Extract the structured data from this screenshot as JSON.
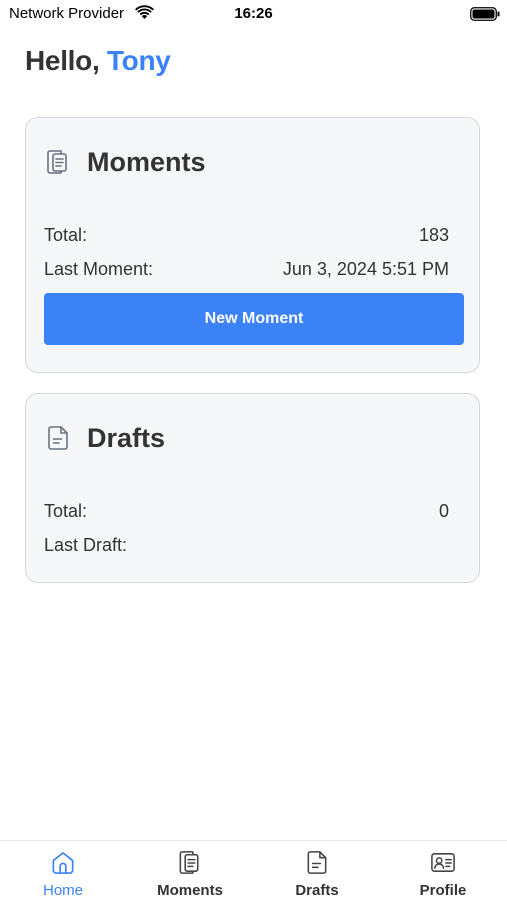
{
  "status_bar": {
    "carrier": "Network Provider",
    "time": "16:26"
  },
  "greeting": {
    "prefix": "Hello,",
    "name": "Tony"
  },
  "moments_card": {
    "icon": "moments-icon",
    "title": "Moments",
    "total_label": "Total:",
    "total_value": "183",
    "last_label": "Last Moment:",
    "last_value": "Jun 3, 2024 5:51 PM",
    "button_label": "New Moment"
  },
  "drafts_card": {
    "icon": "document-icon",
    "title": "Drafts",
    "total_label": "Total:",
    "total_value": "0",
    "last_label": "Last Draft:",
    "last_value": ""
  },
  "tab_bar": {
    "active": "Home",
    "tabs": [
      {
        "label": "Home",
        "icon": "home-icon"
      },
      {
        "label": "Moments",
        "icon": "moments-icon"
      },
      {
        "label": "Drafts",
        "icon": "document-icon"
      },
      {
        "label": "Profile",
        "icon": "profile-card-icon"
      }
    ]
  },
  "colors": {
    "accent": "#3b82f6",
    "text": "#333333",
    "card_bg": "#f6f7f9",
    "card_border": "#d4d7dc"
  }
}
